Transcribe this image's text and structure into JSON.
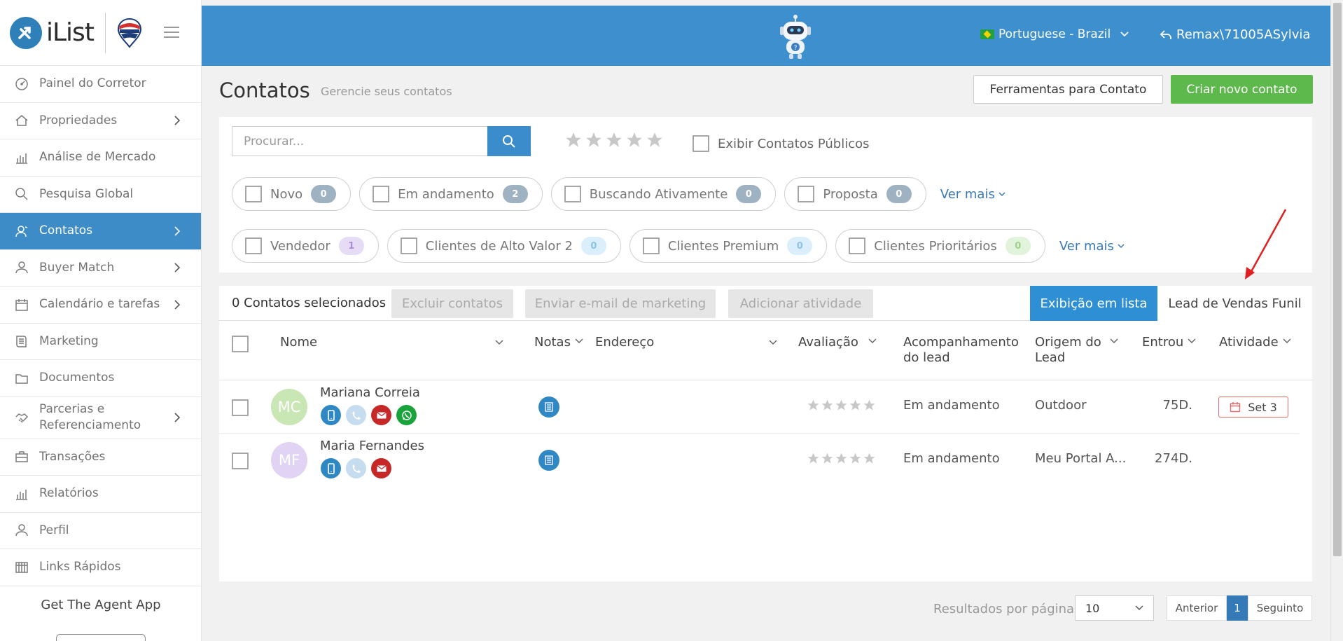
{
  "brand": {
    "name": "iList"
  },
  "sidebar": {
    "items": [
      {
        "label": "Painel do Corretor",
        "icon": "gauge-icon",
        "chevron": false,
        "active": false
      },
      {
        "label": "Propriedades",
        "icon": "home-icon",
        "chevron": true,
        "active": false
      },
      {
        "label": "Análise de Mercado",
        "icon": "bar-chart-icon",
        "chevron": false,
        "active": false
      },
      {
        "label": "Pesquisa Global",
        "icon": "search-icon",
        "chevron": false,
        "active": false
      },
      {
        "label": "Contatos",
        "icon": "contacts-icon",
        "chevron": true,
        "active": true
      },
      {
        "label": "Buyer Match",
        "icon": "user-icon",
        "chevron": true,
        "active": false
      },
      {
        "label": "Calendário e tarefas",
        "icon": "calendar-icon",
        "chevron": true,
        "active": false
      },
      {
        "label": "Marketing",
        "icon": "book-icon",
        "chevron": false,
        "active": false
      },
      {
        "label": "Documentos",
        "icon": "folder-icon",
        "chevron": false,
        "active": false
      },
      {
        "label_line1": "Parcerias e",
        "label_line2": "Referenciamento",
        "icon": "handshake-icon",
        "chevron": true,
        "active": false
      },
      {
        "label": "Transações",
        "icon": "briefcase-icon",
        "chevron": false,
        "active": false
      },
      {
        "label": "Relatórios",
        "icon": "bar-chart-icon",
        "chevron": false,
        "active": false
      },
      {
        "label": "Perfil",
        "icon": "user-icon",
        "chevron": false,
        "active": false
      },
      {
        "label": "Links Rápidos",
        "icon": "grid-icon",
        "chevron": false,
        "active": false
      }
    ],
    "get_app": "Get The Agent App"
  },
  "topbar": {
    "language": "Portuguese - Brazil",
    "user": "Remax\\71005ASylvia"
  },
  "header": {
    "title": "Contatos",
    "subtitle": "Gerencie seus contatos",
    "tools_button": "Ferramentas para Contato",
    "create_button": "Criar novo contato"
  },
  "filters": {
    "search_placeholder": "Procurar...",
    "public_contacts_label": "Exibir Contatos Públicos",
    "row1": [
      {
        "label": "Novo",
        "count": "0",
        "badge_bg": "#9fb2c2",
        "badge_fg": "#ffffff"
      },
      {
        "label": "Em andamento",
        "count": "2",
        "badge_bg": "#9fb2c2",
        "badge_fg": "#ffffff"
      },
      {
        "label": "Buscando Ativamente",
        "count": "0",
        "badge_bg": "#9fb2c2",
        "badge_fg": "#ffffff"
      },
      {
        "label": "Proposta",
        "count": "0",
        "badge_bg": "#9fb2c2",
        "badge_fg": "#ffffff"
      }
    ],
    "row2": [
      {
        "label": "Vendedor",
        "count": "1",
        "badge_bg": "#e7dcf5",
        "badge_fg": "#a98bd6"
      },
      {
        "label": "Clientes de Alto Valor 2",
        "count": "0",
        "badge_bg": "#dbeefb",
        "badge_fg": "#8cc3ea"
      },
      {
        "label": "Clientes Premium",
        "count": "0",
        "badge_bg": "#dbeefb",
        "badge_fg": "#8cc3ea"
      },
      {
        "label": "Clientes Prioritários",
        "count": "0",
        "badge_bg": "#e2f3dc",
        "badge_fg": "#9fd18e"
      }
    ],
    "ver_mais": "Ver mais"
  },
  "toolbar": {
    "selected": "0 Contatos selecionados",
    "delete": "Excluir contatos",
    "email": "Enviar e-mail de marketing",
    "activity": "Adicionar atividade",
    "list_view": "Exibição em lista",
    "funnel_view": "Lead de Vendas Funil"
  },
  "table": {
    "columns": {
      "name": "Nome",
      "notes": "Notas",
      "address": "Endereço",
      "rating": "Avaliação",
      "followup_line1": "Acompanhamento",
      "followup_line2": "do lead",
      "origin_line1": "Origem do",
      "origin_line2": "Lead",
      "entered": "Entrou",
      "activity": "Atividade"
    },
    "rows": [
      {
        "initials": "MC",
        "avatar_color": "#c9e6b5",
        "name": "Mariana Correia",
        "whatsapp": true,
        "status": "Em andamento",
        "origin": "Outdoor",
        "entered": "75D.",
        "activity": "Set 3"
      },
      {
        "initials": "MF",
        "avatar_color": "#e1d3f4",
        "name": "Maria Fernandes",
        "whatsapp": false,
        "status": "Em andamento",
        "origin": "Meu Portal A...",
        "entered": "274D.",
        "activity": ""
      }
    ]
  },
  "pagination": {
    "per_page_label": "Resultados por página",
    "per_page": "10",
    "prev": "Anterior",
    "current": "1",
    "next": "Seguinto"
  },
  "colors": {
    "topbar": "#3d8fce",
    "sidebar_active": "#3d8bc7",
    "primary_button": "#3b8ccb",
    "create_button": "#5db94b"
  }
}
